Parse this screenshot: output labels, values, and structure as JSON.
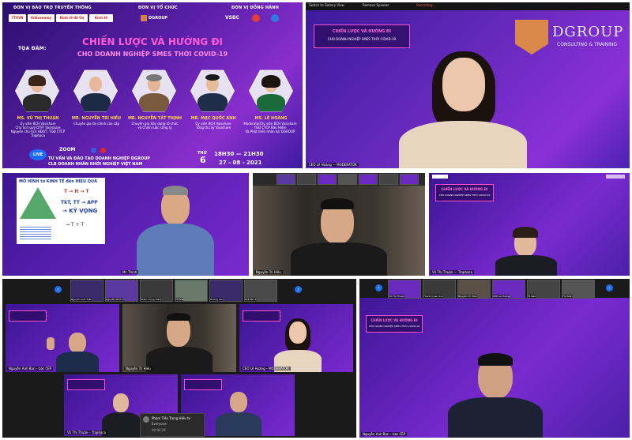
{
  "colors": {
    "accent_pink": "#ff4fd0",
    "accent_yellow": "#ffd54a",
    "purple_dark": "#2a0f6e",
    "zoom_blue": "#1e6ff0"
  },
  "poster": {
    "sponsor_media": "ĐƠN VỊ BẢO TRỢ TRUYỀN THÔNG",
    "organizer": "ĐƠN VỊ TỔ CHỨC",
    "co_host": "ĐƠN VỊ ĐỒNG HÀNH",
    "logos": [
      "TTXVN",
      "VnEconomy",
      "Kinh tế đô thị",
      "Kinh tế",
      "DGROUP",
      "VSBC",
      "logo-red",
      "logo-blue"
    ],
    "seminar_label": "TỌA ĐÀM:",
    "title_line1": "CHIẾN LƯỢC VÀ HƯỚNG ĐI",
    "title_line2": "CHO DOANH NGHIỆP SMES THỜI COVID-19",
    "speakers": [
      {
        "name": "MS. VŨ THỊ THUẬN",
        "role": "Ủy viên BCH Vasishare\nChủ tịch quỹ DTFF Vasishare\nNguyên chủ tịch HĐQT, TGĐ CTCP Traphaco"
      },
      {
        "name": "MR. NGUYỄN TRÍ HIẾU",
        "role": "Chuyên gia tài chính cao cấp"
      },
      {
        "name": "MR. NGUYỄN TẤT THỊNH",
        "role": "Chuyên gia Xây dựng tổ chức\nvà Chiến lược công ty"
      },
      {
        "name": "MR. MẠC QUỐC ANH",
        "role": "Ủy viên BCH Vasishare\nTổng thư ký Vasishare"
      },
      {
        "name": "MS. LÊ HOÀNG",
        "role": "Moderator/Ủy viên BCH Vasishare\nTGĐ CTCP Bảo Hiểm\nVà Phát triển nhân lực DGROUP"
      }
    ],
    "zoom_label": "ZOOM",
    "live_label": "LIVE",
    "day_label": "THỨ",
    "day_num": "6",
    "time": "18H30 — 21H30",
    "date": "27 - 08 - 2021",
    "footer1": "TƯ VẤN VÀ ĐÀO TẠO DOANH NGHIỆP DGROUP",
    "footer2": "CLB DOANH NHÂN KHỞI NGHIỆP VIỆT NAM"
  },
  "tile_dgroup": {
    "toolbar_items": [
      "Switch to Gallery View",
      "Remove Speaker",
      "Recording..."
    ],
    "brand": "DGROUP",
    "brand_sub": "CONSULTING & TRAINING",
    "small_title1": "CHIẾN LƯỢC VÀ HƯỚNG ĐI",
    "small_title2": "CHO DOANH NGHIỆP SMES THỜI COVID-19",
    "name_label": "CEO Lê Hoàng — MODERATOR"
  },
  "tile_slide": {
    "slide_title": "MÔ HÌNH tư KINH TẾ đến HIỆU QUẢ",
    "slide_eq1": "T → H → T",
    "slide_eq2": "TkT, TT → APP",
    "slide_eq3": "→ KỲ VỌNG",
    "slide_eq4": "→ T + T",
    "name_label": "Mr. Thịnh"
  },
  "tile_mr_hieu": {
    "name_label": "Nguyễn Trí Hiếu"
  },
  "tile_ms_thuan": {
    "small_title1": "CHIẾN LƯỢC VÀ HƯỚNG ĐI",
    "small_title2": "CHO DOANH NGHIỆP SMES THỜI COVID-19",
    "name_label": "Vũ Thị Thuận — Traphaco"
  },
  "tile_gallery": {
    "strip": [
      "Nguyễn Anh Tuấn",
      "Nguyễn Minh Tú",
      "Phạm Trọng Hiếu",
      "TTXVN",
      "Hoàng Văn",
      "PTE Bà Lê"
    ],
    "cell_labels": [
      "Nguyễn Anh Ban – bác CEP",
      "Nguyễn Trí Hiếu",
      "CEO Lê Hoàng – MODERATOR",
      "Vũ Thị Thuận – Traphaco",
      "Phạm Tiến"
    ],
    "chat_name": "Phạm Tiến Trọng Hiếu to",
    "chat_msg": "Everyone",
    "chat_time": "00:00:26"
  },
  "tile_last": {
    "strip": [
      "Vũ Thị Thuận",
      "Thành Quan Sơn",
      "Nguyễn Trí Hiếu",
      "CEO Lê Hoàng",
      "Tô Nam",
      "Thị Tuấn"
    ],
    "small_title1": "CHIẾN LƯỢC VÀ HƯỚNG ĐI",
    "small_title2": "CHO DOANH NGHIỆP SMES THỜI COVID-19",
    "name_label": "Nguyễn Anh Ban – bác CEP"
  }
}
